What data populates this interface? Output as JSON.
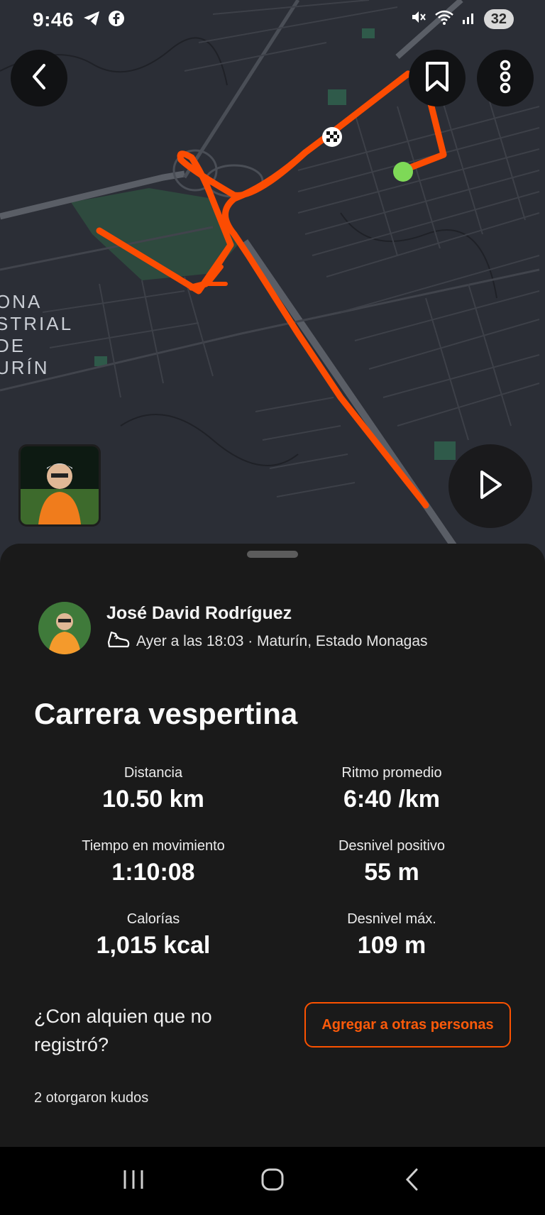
{
  "status_bar": {
    "time": "9:46",
    "battery": "32",
    "left_icons": [
      "telegram-icon",
      "facebook-icon"
    ],
    "right_icons": [
      "mute-icon",
      "wifi-icon",
      "signal-icon"
    ]
  },
  "map": {
    "area_label_lines": [
      "ONA",
      "STRIAL",
      "DE",
      "URÍN"
    ],
    "route_color": "#fc4c02",
    "start_marker_color": "#7ed957"
  },
  "toolbar": {
    "back_icon": "chevron-left-icon",
    "bookmark_icon": "bookmark-icon",
    "more_icon": "more-vertical-icon",
    "play_icon": "play-icon"
  },
  "athlete": {
    "name": "José David Rodríguez",
    "meta": "Ayer a las 18:03 · Maturín, Estado Monagas"
  },
  "activity": {
    "title": "Carrera vespertina"
  },
  "stats": [
    {
      "label": "Distancia",
      "value": "10.50 km"
    },
    {
      "label": "Ritmo promedio",
      "value": "6:40 /km"
    },
    {
      "label": "Tiempo en movimiento",
      "value": "1:10:08"
    },
    {
      "label": "Desnivel positivo",
      "value": "55 m"
    },
    {
      "label": "Calorías",
      "value": "1,015 kcal"
    },
    {
      "label": "Desnivel máx.",
      "value": "109 m"
    }
  ],
  "tagging": {
    "question": "¿Con alquien que no registró?",
    "button_label": "Agregar a otras personas"
  },
  "kudos": {
    "text": "2 otorgaron kudos"
  },
  "colors": {
    "accent": "#fc5200",
    "sheet_bg": "#1a1a1a",
    "map_bg": "#2b2e36"
  }
}
